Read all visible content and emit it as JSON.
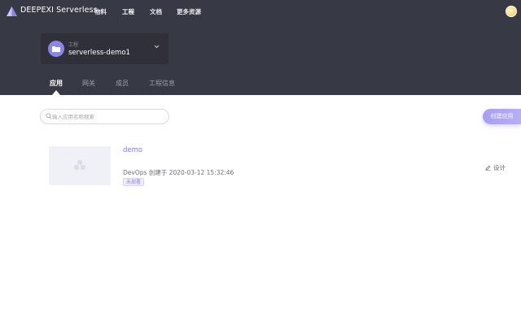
{
  "header": {
    "brand": "DEEPEXI Serverless",
    "nav": [
      "物料",
      "工程",
      "文档",
      "更多资源"
    ],
    "active_nav": "工程"
  },
  "project": {
    "label": "工程",
    "name": "serverless-demo1"
  },
  "tabs": [
    "应用",
    "网关",
    "成员",
    "工程信息"
  ],
  "active_tab": "应用",
  "search": {
    "placeholder": "输入应用名称搜索",
    "value": ""
  },
  "create_button": "创建应用",
  "apps": [
    {
      "name": "demo",
      "meta": "DevOps 创建于 2020-03-12 15:32:46",
      "status": "未部署",
      "action": "设计"
    }
  ],
  "icons": {
    "logo": "triangle-logo-icon",
    "avatar": "user-avatar",
    "project": "folder-icon",
    "chevron": "chevron-down-icon",
    "search": "search-icon",
    "thumbnail": "app-placeholder-icon",
    "design": "edit-icon"
  },
  "colors": {
    "header_bg": "#373944",
    "accent": "#8c86e3",
    "create_button": "#a69ff0"
  }
}
